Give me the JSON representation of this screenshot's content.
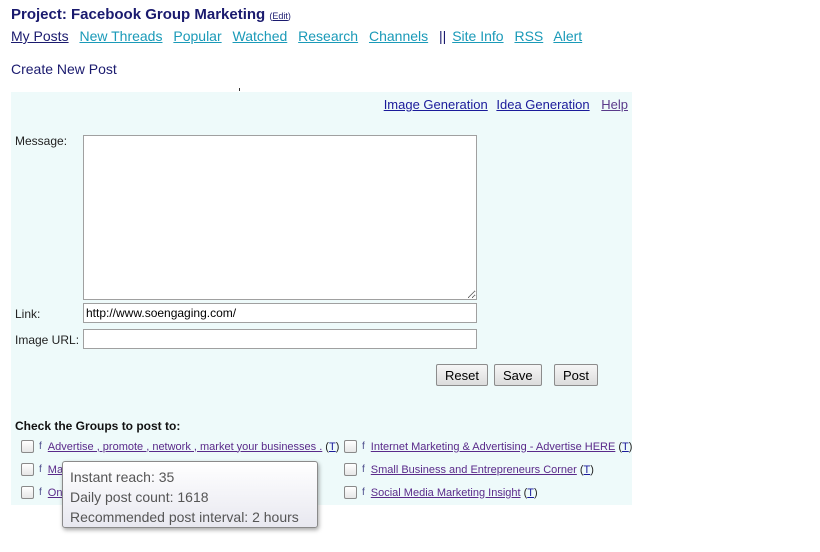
{
  "header": {
    "title": "Project: Facebook Group Marketing",
    "edit_label": "Edit"
  },
  "nav": {
    "items": [
      {
        "label": "My Posts"
      },
      {
        "label": "New Threads"
      },
      {
        "label": "Popular"
      },
      {
        "label": "Watched"
      },
      {
        "label": "Research"
      },
      {
        "label": "Channels"
      },
      {
        "label": "Site Info"
      },
      {
        "label": "RSS"
      },
      {
        "label": "Alert"
      }
    ],
    "separator": "||"
  },
  "create_label": "Create New Post",
  "panel": {
    "top_links": {
      "image_generation": "Image Generation",
      "idea_generation": "Idea Generation",
      "help": "Help"
    },
    "message_label": "Message:",
    "message_value": "",
    "link_label": "Link:",
    "link_value": "http://www.soengaging.com/",
    "image_url_label": "Image URL:",
    "image_url_value": "",
    "buttons": {
      "reset": "Reset",
      "save": "Save",
      "post": "Post"
    },
    "groups_title": "Check the Groups to post to:",
    "fb_glyph": "f",
    "tag": "T",
    "groups_left": [
      {
        "name": "Advertise , promote , network , market your businesses ."
      },
      {
        "name": "Ma"
      },
      {
        "name": "Onl"
      }
    ],
    "groups_right": [
      {
        "name": "Internet Marketing & Advertising - Advertise HERE"
      },
      {
        "name": "Small Business and Entrepreneurs Corner"
      },
      {
        "name": "Social Media Marketing Insight"
      }
    ]
  },
  "tooltip": {
    "instant_reach": "Instant reach: 35",
    "daily_post_count": "Daily post count: 1618",
    "recommended_interval": "Recommended post interval: 2 hours"
  }
}
